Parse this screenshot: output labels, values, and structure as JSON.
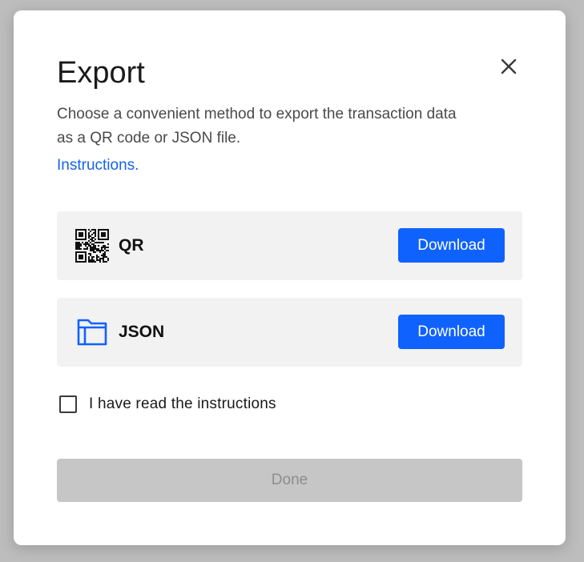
{
  "dialog": {
    "title": "Export",
    "description": "Choose a convenient method to export the transaction data as a QR code or JSON file.",
    "instructions_link": "Instructions.",
    "close_icon": "close-icon"
  },
  "options": [
    {
      "label": "QR",
      "icon": "qr-code-icon",
      "button_label": "Download"
    },
    {
      "label": "JSON",
      "icon": "folder-icon",
      "button_label": "Download"
    }
  ],
  "checkbox": {
    "label": "I have read the instructions",
    "checked": false
  },
  "done_button": {
    "label": "Done",
    "disabled": true
  },
  "colors": {
    "accent": "#0f62fe",
    "link": "#1463e6",
    "option_background": "#f2f2f2",
    "disabled_background": "#c6c6c6",
    "disabled_text": "#8d8d8d",
    "overlay": "#bdbdbd"
  }
}
